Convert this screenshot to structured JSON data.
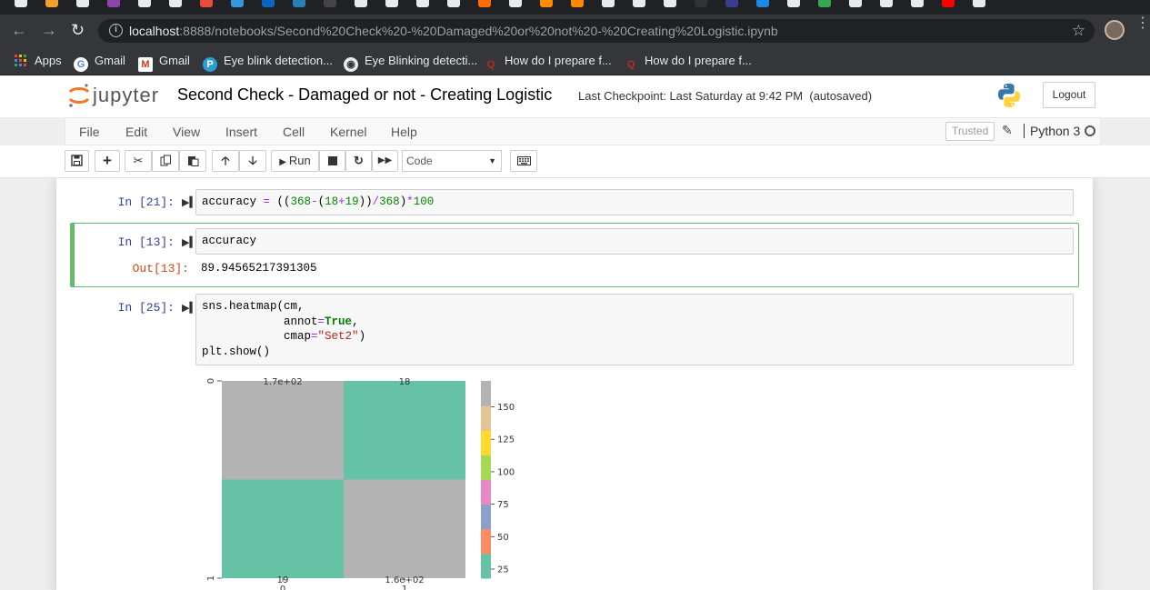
{
  "browser": {
    "url_host": "localhost",
    "url_rest": ":8888/notebooks/Second%20Check%20-%20Damaged%20or%20not%20-%20Creating%20Logistic.ipynb",
    "bookmarks": [
      {
        "label": "Apps",
        "icon": "apps-grid-icon"
      },
      {
        "label": "Gmail",
        "icon": "google-icon"
      },
      {
        "label": "Gmail",
        "icon": "gmail-icon"
      },
      {
        "label": "Eye blink detection...",
        "icon": "pi-icon"
      },
      {
        "label": "Eye Blinking detecti...",
        "icon": "globe-icon"
      },
      {
        "label": "How do I prepare f...",
        "icon": "quora-icon"
      },
      {
        "label": "How do I prepare f...",
        "icon": "quora-icon"
      }
    ]
  },
  "jupyter": {
    "logo_text": "jupyter",
    "notebook_title": "Second Check - Damaged or not - Creating Logistic",
    "checkpoint": "Last Checkpoint: Last Saturday at 9:42 PM",
    "autosave": "(autosaved)",
    "logout_label": "Logout",
    "menu": [
      "File",
      "Edit",
      "View",
      "Insert",
      "Cell",
      "Kernel",
      "Help"
    ],
    "trusted_label": "Trusted",
    "kernel_name": "Python 3",
    "run_label": "Run",
    "cell_type": "Code"
  },
  "cells": [
    {
      "prompt": "In [21]:",
      "code": "accuracy = ((368-(18+19))/368)*100"
    },
    {
      "prompt": "In [13]:",
      "code": "accuracy",
      "out_prompt": "Out[13]:",
      "output": "89.94565217391305"
    },
    {
      "prompt": "In [25]:",
      "code_lines": [
        "sns.heatmap(cm,",
        "            annot=True,",
        "            cmap=\"Set2\")",
        "plt.show()"
      ]
    }
  ],
  "chart_data": {
    "type": "heatmap",
    "x_categories": [
      "0",
      "1"
    ],
    "y_categories": [
      "0",
      "1"
    ],
    "values": [
      [
        170,
        18
      ],
      [
        19,
        160
      ]
    ],
    "annotations": [
      [
        "1.7e+02",
        "18"
      ],
      [
        "19",
        "1.6e+02"
      ]
    ],
    "cell_colors": [
      [
        "#b3b3b3",
        "#66c2a5"
      ],
      [
        "#66c2a5",
        "#b3b3b3"
      ]
    ],
    "colorbar": {
      "ticks": [
        150,
        125,
        100,
        75,
        50,
        25
      ],
      "range": [
        18,
        170
      ],
      "colors": [
        "#66c2a5",
        "#fc8d62",
        "#8da0cb",
        "#e78ac3",
        "#a6d854",
        "#ffd92f",
        "#e5c494",
        "#b3b3b3"
      ]
    },
    "cmap": "Set2"
  }
}
